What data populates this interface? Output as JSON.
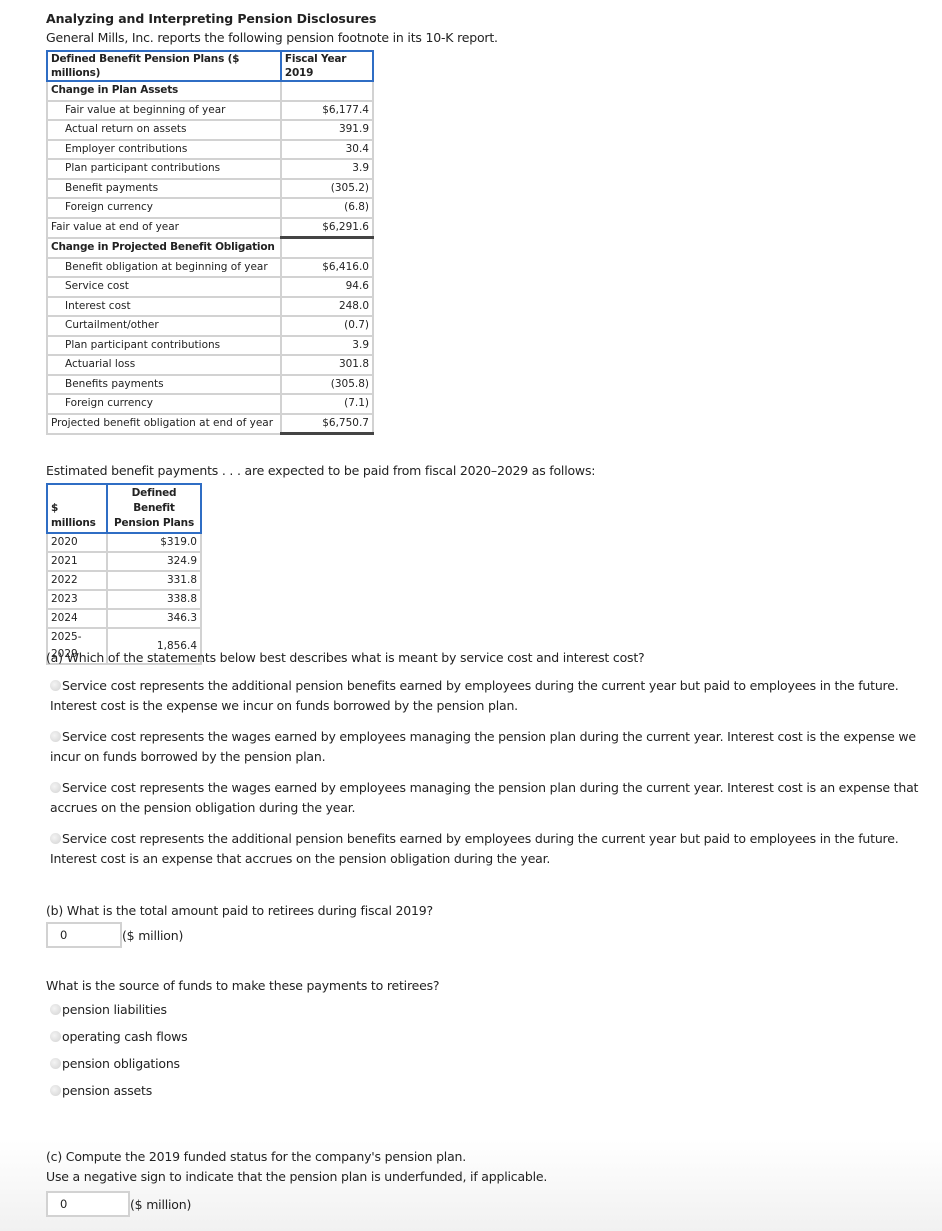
{
  "header": {
    "title": "Analyzing and Interpreting Pension Disclosures",
    "intro": "General Mills, Inc. reports the following pension footnote in its 10-K report."
  },
  "pension_table": {
    "col_label": "Defined Benefit Pension Plans ($ millions)",
    "col_value": "Fiscal Year 2019",
    "section1": "Change in Plan Assets",
    "assets_rows": [
      {
        "label": "Fair value at beginning of year",
        "value": "$6,177.4"
      },
      {
        "label": "Actual return on assets",
        "value": "391.9"
      },
      {
        "label": "Employer contributions",
        "value": "30.4"
      },
      {
        "label": "Plan participant contributions",
        "value": "3.9"
      },
      {
        "label": "Benefit payments",
        "value": "(305.2)"
      },
      {
        "label": "Foreign currency",
        "value": "(6.8)"
      }
    ],
    "assets_total": {
      "label": "Fair value at end of year",
      "value": "$6,291.6"
    },
    "section2": "Change in Projected Benefit Obligation",
    "pbo_rows": [
      {
        "label": "Benefit obligation at beginning of year",
        "value": "$6,416.0"
      },
      {
        "label": "Service cost",
        "value": "94.6"
      },
      {
        "label": "Interest cost",
        "value": "248.0"
      },
      {
        "label": "Curtailment/other",
        "value": "(0.7)"
      },
      {
        "label": "Plan participant contributions",
        "value": "3.9"
      },
      {
        "label": "Actuarial loss",
        "value": "301.8"
      },
      {
        "label": "Benefits payments",
        "value": "(305.8)"
      },
      {
        "label": "Foreign currency",
        "value": "(7.1)"
      }
    ],
    "pbo_total": {
      "label": "Projected benefit obligation at end of year",
      "value": "$6,750.7"
    }
  },
  "estimated": {
    "intro": "Estimated benefit payments . . . are expected to be paid from fiscal 2020–2029 as follows:",
    "col1": "$ millions",
    "col2_line1": "Defined Benefit",
    "col2_line2": "Pension Plans",
    "rows": [
      {
        "year": "2020",
        "value": "$319.0"
      },
      {
        "year": "2021",
        "value": "324.9"
      },
      {
        "year": "2022",
        "value": "331.8"
      },
      {
        "year": "2023",
        "value": "338.8"
      },
      {
        "year": "2024",
        "value": "346.3"
      },
      {
        "year": "2025-2029",
        "value": "1,856.4"
      }
    ]
  },
  "question_a": {
    "prompt": "(a) Which of the statements below best describes what is meant by service cost and interest cost?",
    "options": [
      "Service cost represents the additional pension benefits earned by employees during the current year but paid to employees in the future. Interest cost is the expense we incur on funds borrowed by the pension plan.",
      "Service cost represents the wages earned by employees managing the pension plan during the current year. Interest cost is the expense we incur on funds borrowed by the pension plan.",
      "Service cost represents the wages earned by employees managing the pension plan during the current year. Interest cost is an expense that accrues on the pension obligation during the year.",
      "Service cost represents the additional pension benefits earned by employees during the current year but paid to employees in the future. Interest cost is an expense that accrues on the pension obligation during the year."
    ]
  },
  "question_b": {
    "prompt": "(b) What is the total amount paid to retirees during fiscal 2019?",
    "input_value": "0",
    "unit": "($ million)"
  },
  "question_source": {
    "prompt": "What is the source of funds to make these payments to retirees?",
    "options": [
      "pension liabilities",
      "operating cash flows",
      "pension obligations",
      "pension assets"
    ]
  },
  "question_c": {
    "prompt_line1": "(c) Compute the 2019 funded status for the company's pension plan.",
    "prompt_line2": "Use a negative sign to indicate that the pension plan is underfunded, if applicable.",
    "input_value": "0",
    "unit": "($ million)"
  }
}
